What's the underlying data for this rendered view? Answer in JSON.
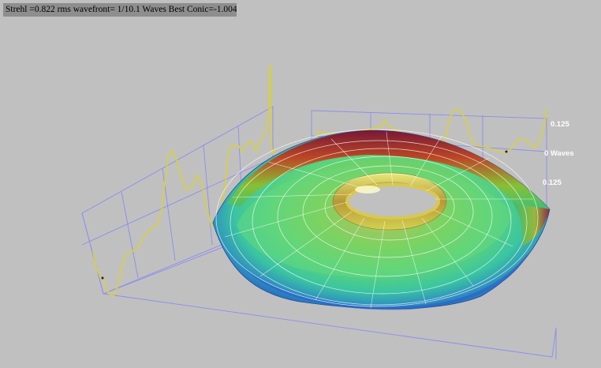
{
  "status_bar": {
    "text": "Strehl =0.822 rms wavefront= 1/10.1 Waves Best Conic=-1.004"
  },
  "axis": {
    "top_label": "0.125",
    "zero_label": "0 Waves",
    "bottom_label": "0.125"
  },
  "colors": {
    "background": "#c0c0c0",
    "grid": "#8c8cf0",
    "profile": "#d7d23a",
    "mesh": "#ffffff",
    "status_bg": "#8e8e8e"
  }
}
